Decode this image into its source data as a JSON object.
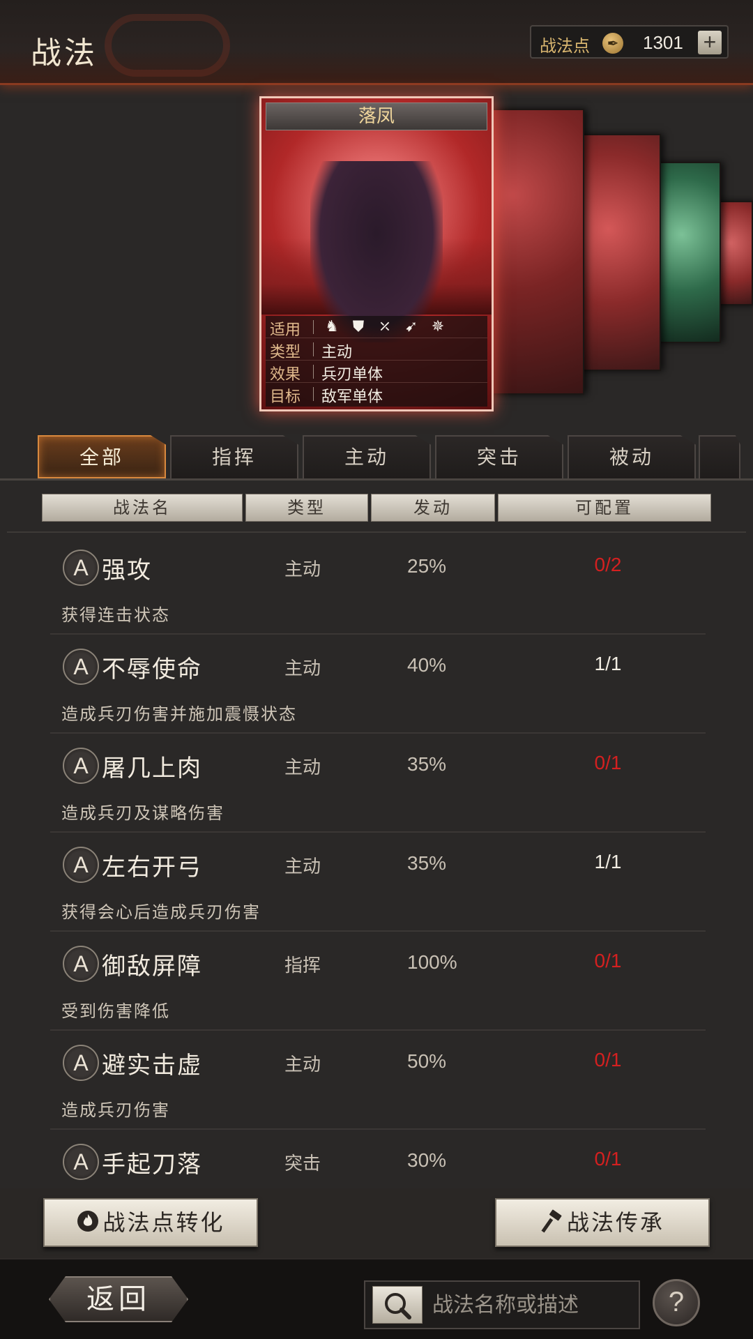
{
  "header": {
    "title": "战法",
    "points_label": "战法点",
    "points_value": "1301",
    "plus_label": "+"
  },
  "card": {
    "name": "落凤",
    "rows": [
      {
        "key": "适用",
        "value": ""
      },
      {
        "key": "类型",
        "value": "主动"
      },
      {
        "key": "效果",
        "value": "兵刃单体"
      },
      {
        "key": "目标",
        "value": "敌军单体"
      }
    ],
    "unit_icons": [
      "cavalry-icon",
      "shield-icon",
      "bow-icon",
      "spear-icon",
      "siege-icon"
    ]
  },
  "tabs": [
    {
      "label": "全部",
      "active": true
    },
    {
      "label": "指挥"
    },
    {
      "label": "主动"
    },
    {
      "label": "突击"
    },
    {
      "label": "被动"
    }
  ],
  "columns": [
    "战法名",
    "类型",
    "发动",
    "可配置"
  ],
  "tactics": [
    {
      "grade": "A",
      "name": "强攻",
      "type": "主动",
      "rate": "25%",
      "avail": "0/2",
      "avail_color": "#d42020",
      "desc": "获得连击状态"
    },
    {
      "grade": "A",
      "name": "不辱使命",
      "type": "主动",
      "rate": "40%",
      "avail": "1/1",
      "avail_color": "#f1ece2",
      "desc": "造成兵刃伤害并施加震慑状态"
    },
    {
      "grade": "A",
      "name": "屠几上肉",
      "type": "主动",
      "rate": "35%",
      "avail": "0/1",
      "avail_color": "#d42020",
      "desc": "造成兵刃及谋略伤害"
    },
    {
      "grade": "A",
      "name": "左右开弓",
      "type": "主动",
      "rate": "35%",
      "avail": "1/1",
      "avail_color": "#f1ece2",
      "desc": "获得会心后造成兵刃伤害"
    },
    {
      "grade": "A",
      "name": "御敌屏障",
      "type": "指挥",
      "rate": "100%",
      "avail": "0/1",
      "avail_color": "#d42020",
      "desc": "受到伤害降低"
    },
    {
      "grade": "A",
      "name": "避实击虚",
      "type": "主动",
      "rate": "50%",
      "avail": "0/1",
      "avail_color": "#d42020",
      "desc": "造成兵刃伤害"
    },
    {
      "grade": "A",
      "name": "手起刀落",
      "type": "突击",
      "rate": "30%",
      "avail": "0/1",
      "avail_color": "#d42020",
      "desc": ""
    }
  ],
  "buttons": {
    "convert": "战法点转化",
    "inherit": "战法传承"
  },
  "footer": {
    "back": "返回",
    "search_placeholder": "战法名称或描述",
    "help": "?"
  }
}
